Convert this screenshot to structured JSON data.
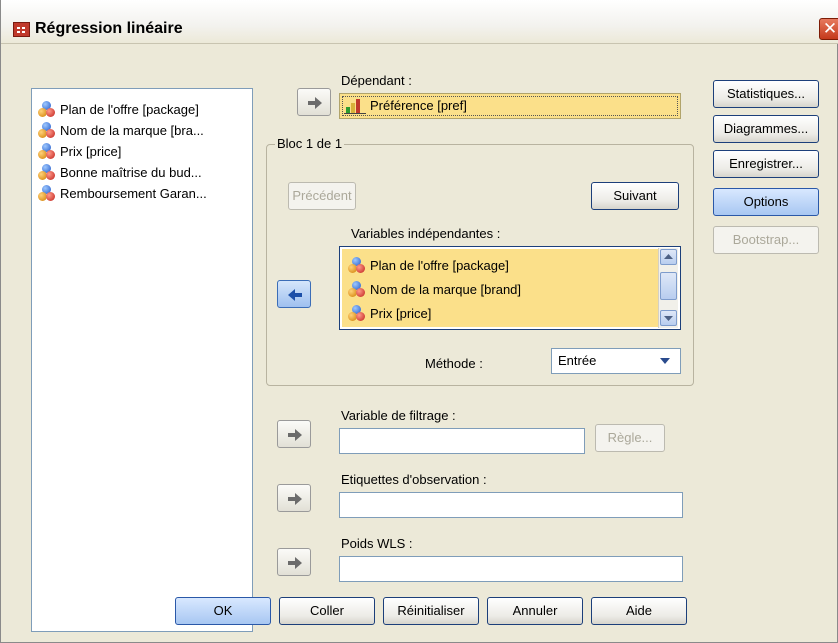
{
  "window": {
    "title": "Régression linéaire",
    "close_glyph": "✕"
  },
  "source_list": {
    "items": [
      {
        "label": "Plan de l'offre [package]"
      },
      {
        "label": "Nom de la marque [bra..."
      },
      {
        "label": "Prix [price]"
      },
      {
        "label": "Bonne maîtrise du bud..."
      },
      {
        "label": "Remboursement Garan..."
      }
    ]
  },
  "dependent": {
    "label": "Dépendant :",
    "value": "Préférence [pref]"
  },
  "block": {
    "legend": "Bloc 1 de 1",
    "previous_label": "Précédent",
    "next_label": "Suivant",
    "independents_label": "Variables indépendantes :",
    "independents": [
      {
        "label": "Plan de l'offre [package]"
      },
      {
        "label": "Nom de la marque [brand]"
      },
      {
        "label": "Prix [price]"
      }
    ],
    "method_label": "Méthode :",
    "method_value": "Entrée"
  },
  "filter": {
    "label": "Variable de filtrage :",
    "value": "",
    "rule_label": "Règle..."
  },
  "case_labels": {
    "label": "Etiquettes d'observation :",
    "value": ""
  },
  "wls": {
    "label": "Poids WLS :",
    "value": ""
  },
  "side_buttons": {
    "statistics": "Statistiques...",
    "plots": "Diagrammes...",
    "save": "Enregistrer...",
    "options": "Options",
    "bootstrap": "Bootstrap..."
  },
  "bottom_buttons": {
    "ok": "OK",
    "paste": "Coller",
    "reset": "Réinitialiser",
    "cancel": "Annuler",
    "help": "Aide"
  },
  "colors": {
    "dialog_bg": "#ece9d8",
    "selected_bg": "#fbe08a",
    "border_blue": "#7f9db9",
    "accent_blue": "#2a58a8",
    "close_red": "#c4391b"
  }
}
